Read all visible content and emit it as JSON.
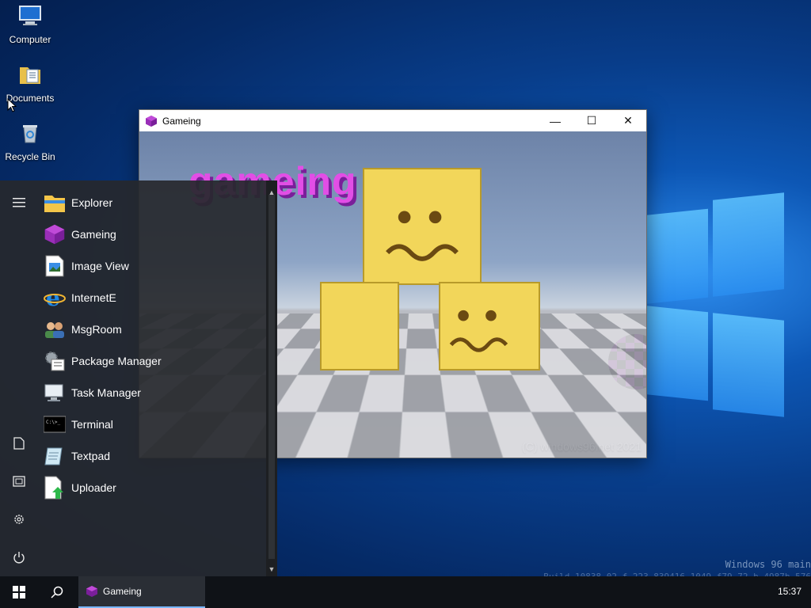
{
  "desktop": {
    "icons": [
      {
        "label": "Computer",
        "icon": "computer-icon"
      },
      {
        "label": "Documents",
        "icon": "folder-documents-icon"
      },
      {
        "label": "Recycle Bin",
        "icon": "recycle-bin-icon"
      }
    ],
    "watermark_line1": "Windows 96 main",
    "watermark_line2": "Build 10838 02 f 223 839416 1049 f79 72 b 4987b 576"
  },
  "window": {
    "title": "Gameing",
    "icon": "gameing-cube-icon",
    "controls": {
      "minimize": "—",
      "maximize": "☐",
      "close": "✕"
    },
    "game_text": "gameing",
    "copyright": "(C) windows96.net 2021"
  },
  "start_menu": {
    "rail": [
      "hamburger-icon",
      "document-icon",
      "pictures-icon",
      "settings-icon",
      "power-icon"
    ],
    "apps": [
      {
        "label": "Explorer",
        "icon": "explorer-folder-icon"
      },
      {
        "label": "Gameing",
        "icon": "gameing-cube-icon"
      },
      {
        "label": "Image View",
        "icon": "image-view-icon"
      },
      {
        "label": "InternetE",
        "icon": "internet-explorer-icon"
      },
      {
        "label": "MsgRoom",
        "icon": "msgroom-users-icon"
      },
      {
        "label": "Package Manager",
        "icon": "package-manager-icon"
      },
      {
        "label": "Task Manager",
        "icon": "task-manager-icon"
      },
      {
        "label": "Terminal",
        "icon": "terminal-icon"
      },
      {
        "label": "Textpad",
        "icon": "textpad-icon"
      },
      {
        "label": "Uploader",
        "icon": "uploader-icon"
      }
    ]
  },
  "taskbar": {
    "active_task": "Gameing",
    "clock": "15:37"
  },
  "colors": {
    "accent": "#78b6ff",
    "start_menu_bg": "#26282c",
    "taskbar_bg": "#0f1217",
    "game_text": "#e24ee6"
  }
}
